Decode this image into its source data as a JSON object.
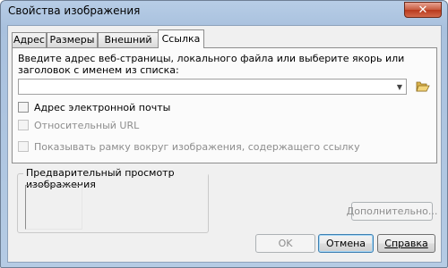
{
  "window": {
    "title": "Свойства изображения",
    "close_glyph": "✕"
  },
  "tabs": [
    {
      "label": "Адрес",
      "active": false
    },
    {
      "label": "Размеры",
      "active": false
    },
    {
      "label": "Внешний вид",
      "active": false
    },
    {
      "label": "Ссылка",
      "active": true
    }
  ],
  "link_tab": {
    "prompt": "Введите адрес веб-страницы, локального файла или выберите якорь или заголовок с именем из списка:",
    "url_input": {
      "value": ""
    },
    "dropdown_icon": "chevron-down-icon",
    "browse_icon": "folder-open-icon",
    "options": [
      {
        "label": "Адрес электронной почты",
        "checked": false,
        "enabled": true
      },
      {
        "label": "Относительный URL",
        "checked": false,
        "enabled": false
      },
      {
        "label": "Показывать рамку вокруг изображения, содержащего ссылку",
        "checked": false,
        "enabled": false
      }
    ]
  },
  "preview": {
    "legend": "Предварительный просмотр изображения"
  },
  "buttons": {
    "advanced": "Дополнительно...",
    "ok": "OK",
    "cancel": "Отмена",
    "help": "Справка"
  },
  "colors": {
    "frame": "#a9c1de",
    "close_button": "#c75a3e",
    "client_bg": "#f0f0f0",
    "disabled_text": "#8d8d8d"
  }
}
